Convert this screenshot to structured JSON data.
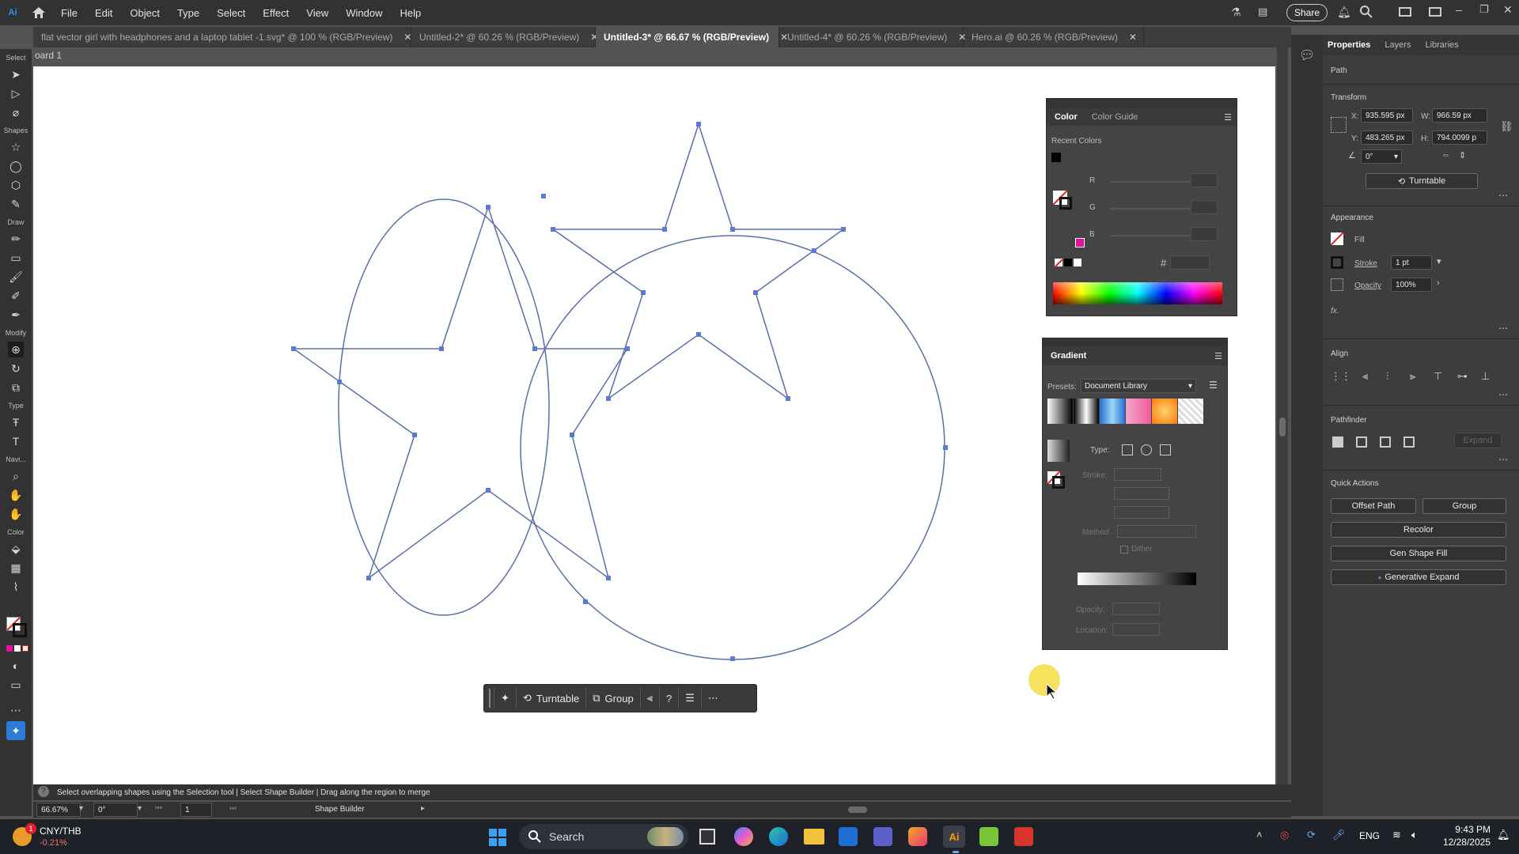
{
  "menubar": {
    "items": [
      "File",
      "Edit",
      "Object",
      "Type",
      "Select",
      "Effect",
      "View",
      "Window",
      "Help"
    ],
    "share_label": "Share"
  },
  "tabs": [
    {
      "label": "flat vector girl with headphones and a laptop tablet -1.svg* @ 100 % (RGB/Preview)",
      "active": false
    },
    {
      "label": "Untitled-2* @ 60.26 % (RGB/Preview)",
      "active": false
    },
    {
      "label": "Untitled-3* @ 66.67 % (RGB/Preview)",
      "active": true
    },
    {
      "label": "Untitled-4* @ 60.26 % (RGB/Preview)",
      "active": false
    },
    {
      "label": "Hero.ai @ 60.26 % (RGB/Preview)",
      "active": false
    }
  ],
  "artboard_label": "oard 1",
  "toolbar": {
    "sections": [
      "Select",
      "Shapes",
      "Draw",
      "Modify",
      "Type",
      "Navi...",
      "Color"
    ]
  },
  "context_bar": {
    "turntable": "Turntable",
    "group": "Group",
    "help": "?"
  },
  "color_panel": {
    "tab_color": "Color",
    "tab_guide": "Color Guide",
    "recent_colors": "Recent Colors",
    "r": "R",
    "g": "G",
    "b": "B",
    "hash": "#",
    "accent": "#e0119b"
  },
  "gradient_panel": {
    "title": "Gradient",
    "presets_label": "Presets:",
    "presets_value": "Document Library",
    "type_label": "Type:",
    "stroke_label": "Stroke:",
    "method_label": "Method:",
    "dither_label": "Dither",
    "opacity_label": "Opacity:",
    "location_label": "Location:"
  },
  "properties": {
    "tabs": [
      "Properties",
      "Layers",
      "Libraries"
    ],
    "object_type": "Path",
    "transform_title": "Transform",
    "x_label": "X:",
    "x_value": "935.595 px",
    "y_label": "Y:",
    "y_value": "483.265 px",
    "w_label": "W:",
    "w_value": "966.59 px",
    "h_label": "H:",
    "h_value": "794.0099 p",
    "angle_value": "0°",
    "turntable_label": "Turntable",
    "appearance_title": "Appearance",
    "fill_label": "Fill",
    "stroke_label": "Stroke",
    "stroke_value": "1 pt",
    "opacity_label": "Opacity",
    "opacity_value": "100%",
    "fx_label": "fx.",
    "align_title": "Align",
    "pathfinder_title": "Pathfinder",
    "expand_label": "Expand",
    "quick_actions_title": "Quick Actions",
    "offset_path": "Offset Path",
    "group": "Group",
    "recolor": "Recolor",
    "gen_shape_fill": "Gen Shape Fill",
    "generative_expand": "Generative Expand"
  },
  "status": {
    "message": "Select overlapping shapes using the Selection tool  |  Select Shape Builder  |  Drag along the region to merge",
    "zoom": "66.67%",
    "rotate": "0°",
    "artboard_num": "1",
    "tool_name": "Shape Builder"
  },
  "taskbar": {
    "stock_name": "CNY/THB",
    "stock_change": "-0.21%",
    "badge": "1",
    "search_placeholder": "Search",
    "lang": "ENG",
    "time": "9:43 PM",
    "date": "12/28/2025"
  }
}
